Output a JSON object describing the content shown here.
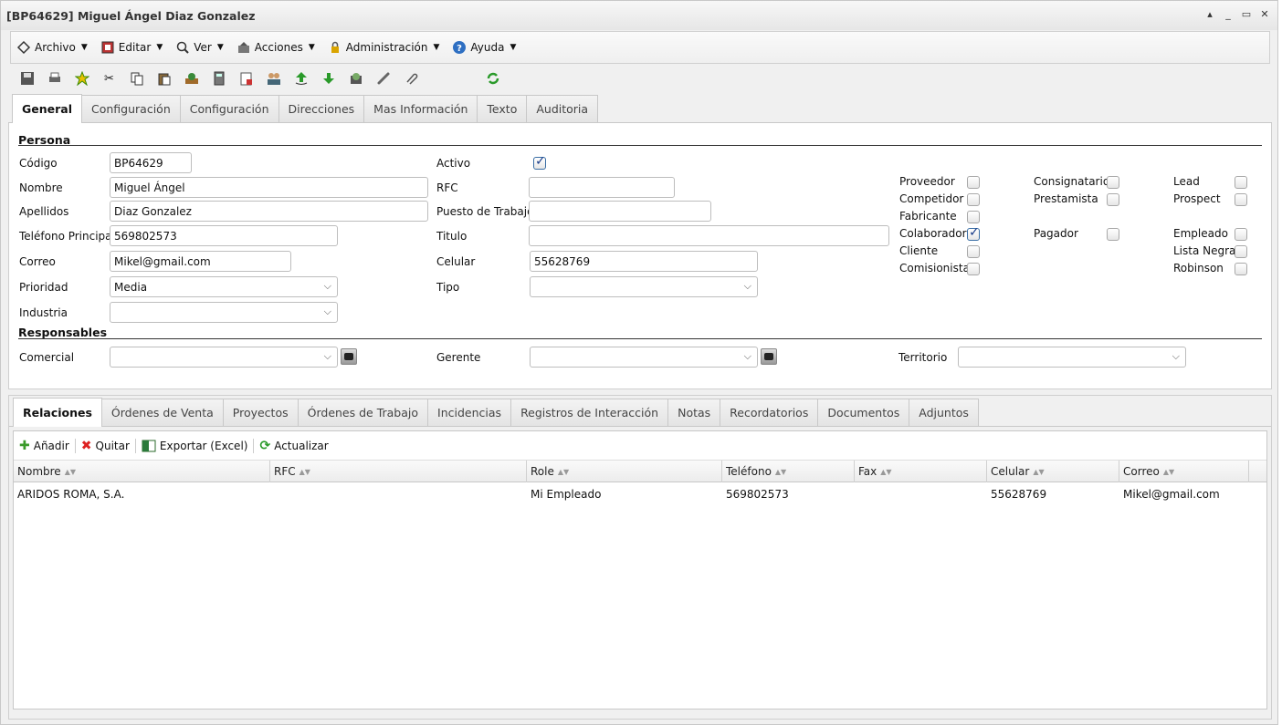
{
  "window": {
    "title": "[BP64629] Miguel Ángel Diaz Gonzalez",
    "controls": [
      "▴",
      "_",
      "▭",
      "✕"
    ]
  },
  "menubar": [
    {
      "label": "Archivo",
      "icon": "file-icon"
    },
    {
      "label": "Editar",
      "icon": "edit-icon"
    },
    {
      "label": "Ver",
      "icon": "view-icon"
    },
    {
      "label": "Acciones",
      "icon": "actions-icon"
    },
    {
      "label": "Administración",
      "icon": "lock-icon"
    },
    {
      "label": "Ayuda",
      "icon": "help-icon"
    }
  ],
  "toolbar_icons": [
    "save-icon",
    "print-icon",
    "favorite-icon",
    "cut-icon",
    "copy-icon",
    "paste-icon",
    "process-icon",
    "calculator-icon",
    "report-icon",
    "users-icon",
    "upload-icon",
    "download-icon",
    "archive-icon",
    "link-icon",
    "attachment-icon",
    "refresh-icon"
  ],
  "tabs": [
    "General",
    "Configuración",
    "Configuración",
    "Direcciones",
    "Mas Información",
    "Texto",
    "Auditoria"
  ],
  "persona": {
    "section": "Persona",
    "codigo": {
      "label": "Código",
      "value": "BP64629"
    },
    "nombre": {
      "label": "Nombre",
      "value": "Miguel Ángel"
    },
    "apellidos": {
      "label": "Apellidos",
      "value": "Diaz Gonzalez"
    },
    "telefono": {
      "label": "Teléfono Principal",
      "value": "569802573"
    },
    "correo": {
      "label": "Correo",
      "value": "Mikel@gmail.com"
    },
    "prioridad": {
      "label": "Prioridad",
      "value": "Media"
    },
    "industria": {
      "label": "Industria",
      "value": ""
    },
    "activo": {
      "label": "Activo",
      "checked": true
    },
    "rfc": {
      "label": "RFC",
      "value": ""
    },
    "puesto": {
      "label": "Puesto de Trabajo",
      "value": ""
    },
    "titulo": {
      "label": "Titulo",
      "value": ""
    },
    "celular": {
      "label": "Celular",
      "value": "55628769"
    },
    "tipo": {
      "label": "Tipo",
      "value": ""
    }
  },
  "flags": {
    "proveedor": {
      "label": "Proveedor",
      "checked": false
    },
    "competidor": {
      "label": "Competidor",
      "checked": false
    },
    "fabricante": {
      "label": "Fabricante",
      "checked": false
    },
    "colaborador": {
      "label": "Colaborador",
      "checked": true
    },
    "cliente": {
      "label": "Cliente",
      "checked": false
    },
    "comisionista": {
      "label": "Comisionista",
      "checked": false
    },
    "consignatario": {
      "label": "Consignatario",
      "checked": false
    },
    "prestamista": {
      "label": "Prestamista",
      "checked": false
    },
    "pagador": {
      "label": "Pagador",
      "checked": false
    },
    "lead": {
      "label": "Lead",
      "checked": false
    },
    "prospect": {
      "label": "Prospect",
      "checked": false
    },
    "empleado": {
      "label": "Empleado",
      "checked": false
    },
    "lista_negra": {
      "label": "Lista Negra",
      "checked": false
    },
    "robinson": {
      "label": "Robinson",
      "checked": false
    }
  },
  "responsables": {
    "section": "Responsables",
    "comercial": {
      "label": "Comercial",
      "value": ""
    },
    "gerente": {
      "label": "Gerente",
      "value": ""
    },
    "territorio": {
      "label": "Territorio",
      "value": ""
    }
  },
  "bottom_tabs": [
    "Relaciones",
    "Órdenes de Venta",
    "Proyectos",
    "Órdenes de Trabajo",
    "Incidencias",
    "Registros de Interacción",
    "Notas",
    "Recordatorios",
    "Documentos",
    "Adjuntos"
  ],
  "grid": {
    "tools": {
      "add": "Añadir",
      "remove": "Quitar",
      "export": "Exportar (Excel)",
      "refresh": "Actualizar"
    },
    "columns": [
      "Nombre",
      "RFC",
      "Role",
      "Teléfono",
      "Fax",
      "Celular",
      "Correo"
    ],
    "rows": [
      [
        "ARIDOS ROMA, S.A.",
        "",
        "Mi Empleado",
        "569802573",
        "",
        "55628769",
        "Mikel@gmail.com"
      ]
    ]
  }
}
